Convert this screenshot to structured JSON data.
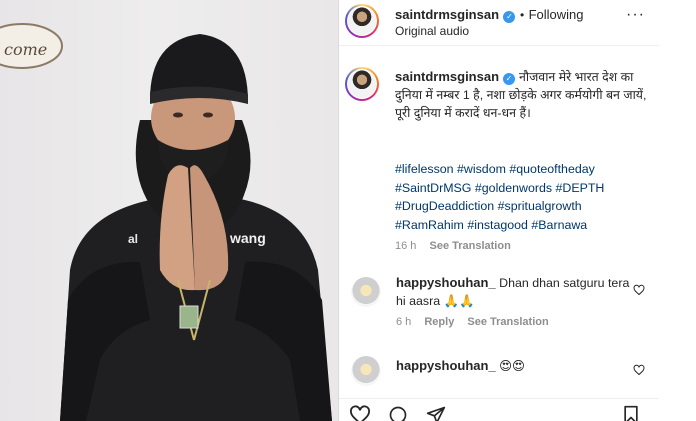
{
  "post": {
    "username": "saintdrmsginsan",
    "audio": "Original audio",
    "follow_separator": "•",
    "follow_status": "Following",
    "more_label": "···"
  },
  "photo": {
    "wall_sign": "come",
    "shirt_text_left": "al",
    "shirt_text_right": "wang"
  },
  "caption": {
    "username": "saintdrmsginsan",
    "text": "नौजवान मेरे भारत देश का दुनिया में नम्बर 1 है, नशा छोड़के अगर कर्मयोगी बन जायें, पूरी दुनिया में करादें धन-धन हैं।",
    "hashtags_line1": [
      "#lifelesson",
      "#wisdom",
      "#quoteoftheday"
    ],
    "hashtags_line2": [
      "#SaintDrMSG",
      "#goldenwords",
      "#DEPTH"
    ],
    "hashtags_line3": [
      "#DrugDeaddiction",
      "#spritualgrowth"
    ],
    "hashtags_line4": [
      "#RamRahim",
      "#instagood",
      "#Barnawa"
    ],
    "time": "16 h",
    "see_translation": "See Translation"
  },
  "comments": [
    {
      "username": "happyshouhan_",
      "text": "Dhan dhan satguru tera hi aasra 🙏🙏",
      "time": "6 h",
      "reply": "Reply",
      "see_translation": "See Translation"
    },
    {
      "username": "happyshouhan_",
      "text": "😍😍"
    }
  ],
  "icons": {
    "like": "heart-icon",
    "comment": "comment-icon",
    "share": "share-icon",
    "save": "bookmark-icon"
  },
  "colors": {
    "link": "#00376b",
    "verified": "#3897f0",
    "muted": "#8e8e8e"
  }
}
